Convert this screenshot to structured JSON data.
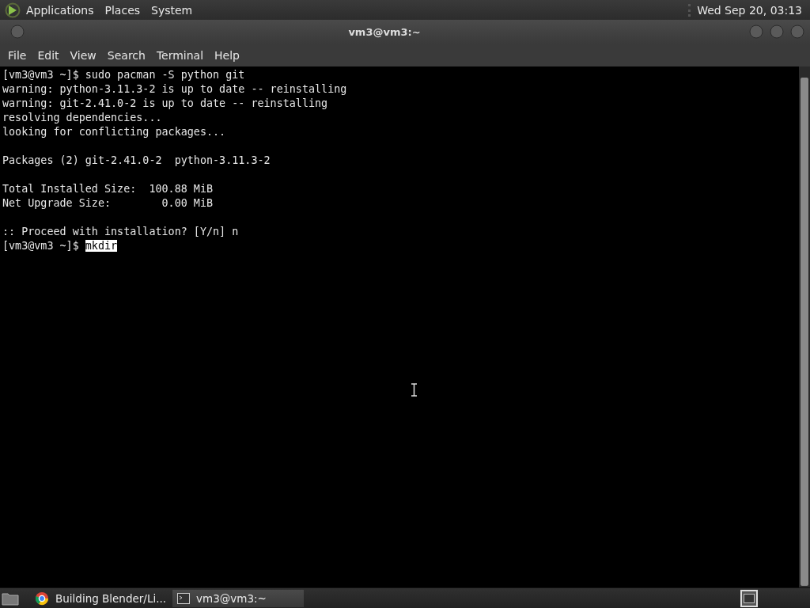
{
  "top_panel": {
    "menus": [
      "Applications",
      "Places",
      "System"
    ],
    "clock": "Wed Sep 20, 03:13"
  },
  "window": {
    "title": "vm3@vm3:~"
  },
  "menubar": [
    "File",
    "Edit",
    "View",
    "Search",
    "Terminal",
    "Help"
  ],
  "terminal": {
    "lines": [
      {
        "kind": "output",
        "text": "[vm3@vm3 ~]$ sudo pacman -S python git"
      },
      {
        "kind": "output",
        "text": "warning: python-3.11.3-2 is up to date -- reinstalling"
      },
      {
        "kind": "output",
        "text": "warning: git-2.41.0-2 is up to date -- reinstalling"
      },
      {
        "kind": "output",
        "text": "resolving dependencies..."
      },
      {
        "kind": "output",
        "text": "looking for conflicting packages..."
      },
      {
        "kind": "blank"
      },
      {
        "kind": "output",
        "text": "Packages (2) git-2.41.0-2  python-3.11.3-2"
      },
      {
        "kind": "blank"
      },
      {
        "kind": "output",
        "text": "Total Installed Size:  100.88 MiB"
      },
      {
        "kind": "output",
        "text": "Net Upgrade Size:        0.00 MiB"
      },
      {
        "kind": "blank"
      },
      {
        "kind": "output",
        "text": ":: Proceed with installation? [Y/n] n"
      },
      {
        "kind": "prompt",
        "prompt": "[vm3@vm3 ~]$",
        "input": "mkdir",
        "selected": true
      }
    ]
  },
  "taskbar": {
    "tasks": [
      {
        "kind": "browser",
        "label": "Building Blender/Li...",
        "selected": false
      },
      {
        "kind": "terminal",
        "label": "vm3@vm3:~",
        "selected": true
      }
    ]
  }
}
